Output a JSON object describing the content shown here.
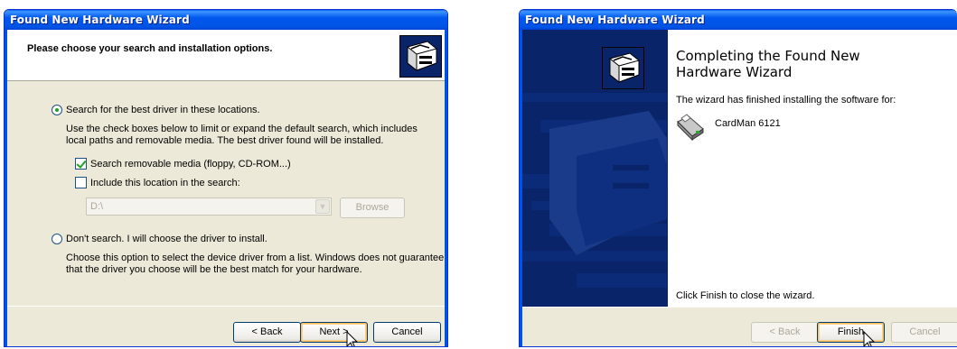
{
  "wizard1": {
    "title": "Found New Hardware Wizard",
    "header": "Please choose your search and installation options.",
    "option_search": "Search for the best driver in these locations.",
    "option_search_desc": "Use the check boxes below to limit or expand the default search, which includes local paths and removable media. The best driver found will be installed.",
    "checkbox_removable": "Search removable media (floppy, CD-ROM...)",
    "checkbox_location": "Include this location in the search:",
    "location_value": "D:\\",
    "browse": "Browse",
    "option_dont_search": "Don't search. I will choose the driver to install.",
    "option_dont_search_desc": "Choose this option to select the device driver from a list.  Windows does not guarantee that the driver you choose will be the best match for your hardware.",
    "back": "< Back",
    "next": "Next >",
    "cancel": "Cancel"
  },
  "wizard2": {
    "title": "Found New Hardware Wizard",
    "heading_line1": "Completing the Found New",
    "heading_line2": "Hardware Wizard",
    "finished_text": "The wizard has finished installing the software for:",
    "device_name": "CardMan 6121",
    "close_text": "Click Finish to close the wizard.",
    "back": "< Back",
    "finish": "Finish",
    "cancel": "Cancel"
  },
  "icons": [
    "hardware-wizard-icon",
    "card-reader-icon",
    "mouse-cursor-icon"
  ],
  "colors": {
    "titlebar": "#0054e3",
    "dialog_bg": "#ece9d8",
    "sidebar": "#0a246a",
    "radio_check": "#21a121"
  }
}
